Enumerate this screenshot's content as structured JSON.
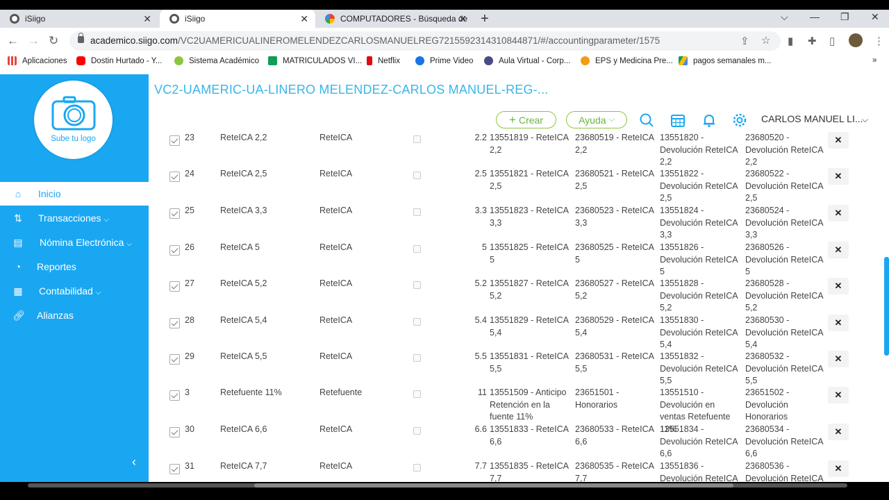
{
  "browser": {
    "tabs": [
      {
        "title": "iSiigo",
        "active": false
      },
      {
        "title": "iSiigo",
        "active": true
      },
      {
        "title": "COMPUTADORES - Búsqueda de",
        "active": false
      }
    ],
    "url_domain": "academico.siigo.com",
    "url_path": "/VC2UAMERICUALINEROMELENDEZCARLOSMANUELREG721559231431084​4871/#/accountingparameter/1575",
    "bookmarks": [
      {
        "label": "Aplicaciones",
        "color": "#e8453c"
      },
      {
        "label": "Dostin Hurtado - Y...",
        "color": "#ff0000"
      },
      {
        "label": "Sistema Académico",
        "color": "#8cc63f"
      },
      {
        "label": "MATRICULADOS VI...",
        "color": "#0f9d58"
      },
      {
        "label": "Netflix",
        "color": "#e50914"
      },
      {
        "label": "Prime Video",
        "color": "#1a73e8"
      },
      {
        "label": "Aula Virtual - Corp...",
        "color": "#4a4a8a"
      },
      {
        "label": "EPS y Medicina Pre...",
        "color": "#f39c12"
      },
      {
        "label": "pagos semanales m...",
        "color": "#fbbc04"
      }
    ]
  },
  "sidebar": {
    "logo_text": "Sube tu logo",
    "items": [
      {
        "label": "Inicio",
        "icon": "home-icon",
        "active": true,
        "chevron": false
      },
      {
        "label": "Transacciones",
        "icon": "transactions-icon",
        "active": false,
        "chevron": true
      },
      {
        "label": "Nómina Electrónica",
        "icon": "payroll-icon",
        "active": false,
        "chevron": true
      },
      {
        "label": "Reportes",
        "icon": "reports-icon",
        "active": false,
        "chevron": false
      },
      {
        "label": "Contabilidad",
        "icon": "accounting-icon",
        "active": false,
        "chevron": true
      },
      {
        "label": "Alianzas",
        "icon": "link-icon",
        "active": false,
        "chevron": false
      }
    ]
  },
  "header": {
    "company": "VC2-UAMERIC-UA-LINERO MELENDEZ-CARLOS MANUEL-REG-...",
    "crear_label": "Crear",
    "ayuda_label": "Ayuda",
    "user_name": "CARLOS MANUEL LI..."
  },
  "table": {
    "rows": [
      {
        "code": "23",
        "name": "ReteICA 2,2",
        "type": "ReteICA",
        "pct": "2.2",
        "acc1": "13551819 - ReteICA 2,2",
        "acc2": "23680519 - ReteICA 2,2",
        "acc3": "13551820 - Devolución ReteICA 2,2",
        "acc4": "23680520 - Devolución ReteICA 2,2"
      },
      {
        "code": "24",
        "name": "ReteICA 2,5",
        "type": "ReteICA",
        "pct": "2.5",
        "acc1": "13551821 - ReteICA 2,5",
        "acc2": "23680521 - ReteICA 2,5",
        "acc3": "13551822 - Devolución ReteICA 2,5",
        "acc4": "23680522 - Devolución ReteICA 2,5"
      },
      {
        "code": "25",
        "name": "ReteICA 3,3",
        "type": "ReteICA",
        "pct": "3.3",
        "acc1": "13551823 - ReteICA 3,3",
        "acc2": "23680523 - ReteICA 3,3",
        "acc3": "13551824 - Devolución ReteICA 3,3",
        "acc4": "23680524 - Devolución ReteICA 3,3"
      },
      {
        "code": "26",
        "name": "ReteICA 5",
        "type": "ReteICA",
        "pct": "5",
        "acc1": "13551825 - ReteICA 5",
        "acc2": "23680525 - ReteICA 5",
        "acc3": "13551826 - Devolución ReteICA 5",
        "acc4": "23680526 - Devolución ReteICA 5"
      },
      {
        "code": "27",
        "name": "ReteICA 5,2",
        "type": "ReteICA",
        "pct": "5.2",
        "acc1": "13551827 - ReteICA 5,2",
        "acc2": "23680527 - ReteICA 5,2",
        "acc3": "13551828 - Devolución ReteICA 5,2",
        "acc4": "23680528 - Devolución ReteICA 5,2"
      },
      {
        "code": "28",
        "name": "ReteICA 5,4",
        "type": "ReteICA",
        "pct": "5.4",
        "acc1": "13551829 - ReteICA 5,4",
        "acc2": "23680529 - ReteICA 5,4",
        "acc3": "13551830 - Devolución ReteICA 5,4",
        "acc4": "23680530 - Devolución ReteICA 5,4"
      },
      {
        "code": "29",
        "name": "ReteICA 5,5",
        "type": "ReteICA",
        "pct": "5.5",
        "acc1": "13551831 - ReteICA 5,5",
        "acc2": "23680531 - ReteICA 5,5",
        "acc3": "13551832 - Devolución ReteICA 5,5",
        "acc4": "23680532 - Devolución ReteICA 5,5"
      },
      {
        "code": "3",
        "name": "Retefuente 11%",
        "type": "Retefuente",
        "pct": "11",
        "acc1": "13551509 - Anticipo Retención en la fuente 11%",
        "acc2": "23651501 - Honorarios",
        "acc3": "13551510 - Devolución en ventas Retefuente 11%",
        "acc4": "23651502 - Devolución Honorarios"
      },
      {
        "code": "30",
        "name": "ReteICA 6,6",
        "type": "ReteICA",
        "pct": "6.6",
        "acc1": "13551833 - ReteICA 6,6",
        "acc2": "23680533 - ReteICA 6,6",
        "acc3": "13551834 - Devolución ReteICA 6,6",
        "acc4": "23680534 - Devolución ReteICA 6,6"
      },
      {
        "code": "31",
        "name": "ReteICA 7,7",
        "type": "ReteICA",
        "pct": "7.7",
        "acc1": "13551835 - ReteICA 7,7",
        "acc2": "23680535 - ReteICA 7,7",
        "acc3": "13551836 - Devolución ReteICA",
        "acc4": "23680536 - Devolución ReteICA"
      }
    ]
  },
  "colors": {
    "sidebar": "#1aa7f2",
    "accent_green": "#8cc63f",
    "company_title": "#38b6e8"
  }
}
